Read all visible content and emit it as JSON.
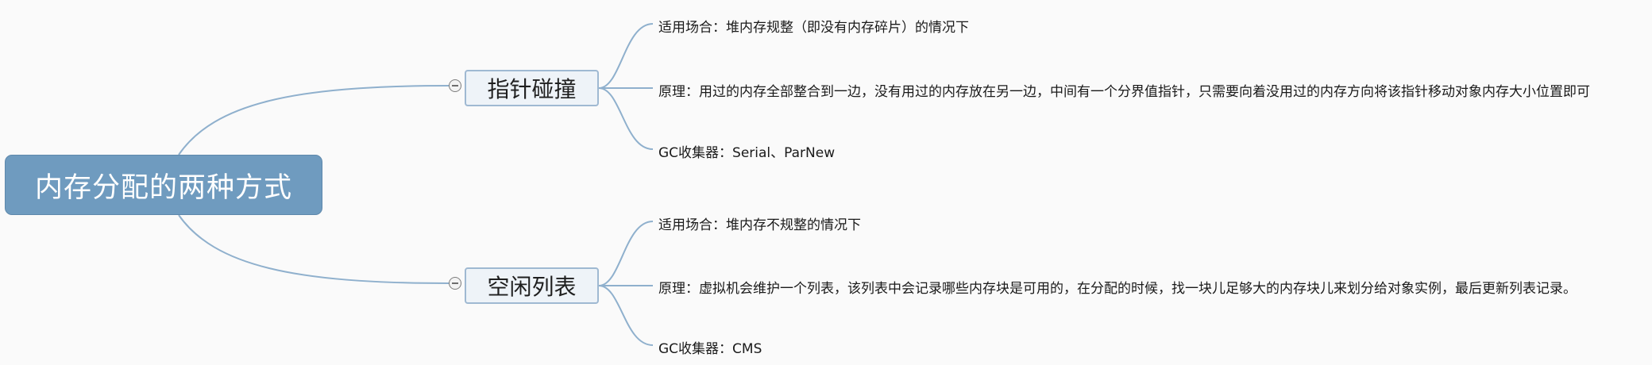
{
  "colors": {
    "root_fill": "#6f9bbf",
    "topic_fill": "#eef3f8",
    "topic_border": "#9fb9d2",
    "connector": "#8fb0cd",
    "background": "#fafafa"
  },
  "root": {
    "label": "内存分配的两种方式"
  },
  "branches": [
    {
      "label": "指针碰撞",
      "collapse_icon": "collapse-minus-icon",
      "leaves": [
        "适用场合：堆内存规整（即没有内存碎片）的情况下",
        "原理：用过的内存全部整合到一边，没有用过的内存放在另一边，中间有一个分界值指针，只需要向着没用过的内存方向将该指针移动对象内存大小位置即可",
        "GC收集器：Serial、ParNew"
      ]
    },
    {
      "label": "空闲列表",
      "collapse_icon": "collapse-minus-icon",
      "leaves": [
        "适用场合：堆内存不规整的情况下",
        "原理：虚拟机会维护一个列表，该列表中会记录哪些内存块是可用的，在分配的时候，找一块儿足够大的内存块儿来划分给对象实例，最后更新列表记录。",
        "GC收集器：CMS"
      ]
    }
  ]
}
